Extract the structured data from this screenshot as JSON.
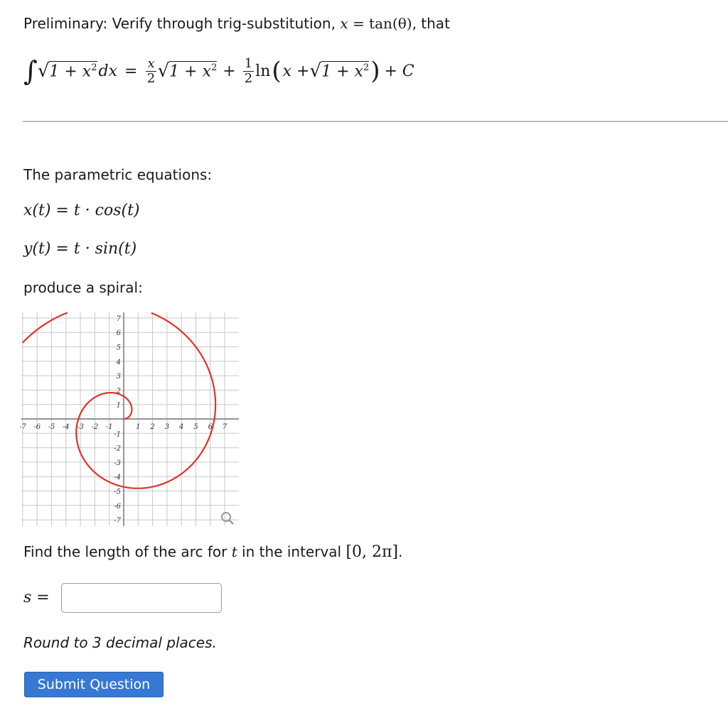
{
  "prelim": {
    "text": "Preliminary: Verify through trig-substitution, ",
    "sub_var": "x",
    "eq": " = ",
    "sub_expr": "tan(θ)",
    "tail": ", that"
  },
  "formula": {
    "integral": "∫",
    "radical": "√",
    "integrand": "1 + x",
    "sq": "2",
    "dx": "dx",
    "eq": "=",
    "frac1_num": "x",
    "frac1_den": "2",
    "term1": "1 + x",
    "plus1": "+",
    "frac2_num": "1",
    "frac2_den": "2",
    "ln": "ln",
    "lparen": "(",
    "xplus": "x + ",
    "term2": "1 + x",
    "rparen": ")",
    "plus_c": "+ C"
  },
  "parametric": {
    "heading": "The parametric equations:",
    "x_eq": "x(t) = t · cos(t)",
    "y_eq": "y(t) = t · sin(t)",
    "spiral_text": "produce a spiral:"
  },
  "graph": {
    "x_ticks": [
      "-7",
      "-6",
      "-5",
      "-4",
      "-3",
      "-2",
      "-1",
      "1",
      "2",
      "3",
      "4",
      "5",
      "6",
      "7"
    ],
    "y_ticks": [
      "7",
      "6",
      "5",
      "4",
      "3",
      "2",
      "1",
      "-1",
      "-2",
      "-3",
      "-4",
      "-5",
      "-6",
      "-7"
    ],
    "curve_color": "#e0342a",
    "zoom_icon": "magnifier-icon"
  },
  "question": {
    "text": "Find the length of the arc for ",
    "var": "t",
    "mid": " in the interval ",
    "interval": "[0, 2π]",
    "end": "."
  },
  "answer": {
    "label": "s =",
    "value": "",
    "placeholder": ""
  },
  "note": "Round to 3 decimal places.",
  "submit_label": "Submit Question"
}
